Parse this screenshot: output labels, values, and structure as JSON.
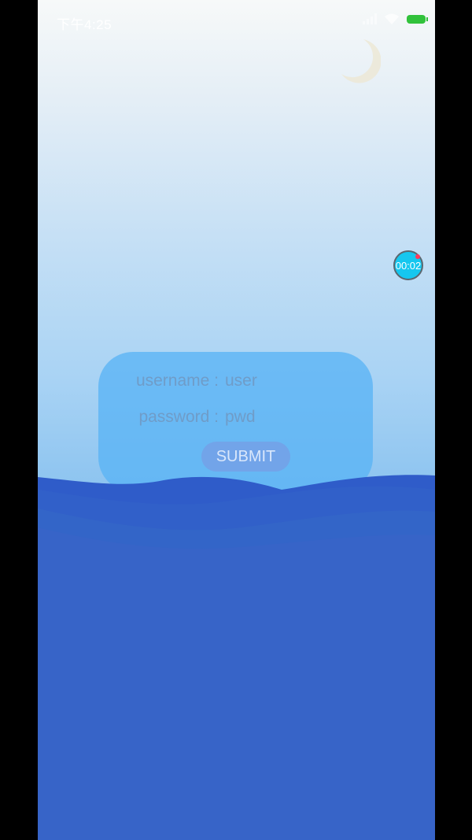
{
  "status_bar": {
    "time": "下午4:25",
    "icons": [
      "signal-icon",
      "wifi-icon",
      "battery-charging-icon"
    ]
  },
  "decor": {
    "moon_icon": "crescent-moon-icon"
  },
  "timer": {
    "label": "00:02"
  },
  "login_form": {
    "username_label": "username :",
    "username_value": "user",
    "password_label": "password :",
    "password_value": "pwd",
    "submit_label": "SUBMIT"
  },
  "colors": {
    "wave_deep": "#3764c8",
    "wave_mid": "#2f58c4",
    "card": "#5ab4f5",
    "battery": "#31c23b",
    "timer": "#16c7ef"
  }
}
